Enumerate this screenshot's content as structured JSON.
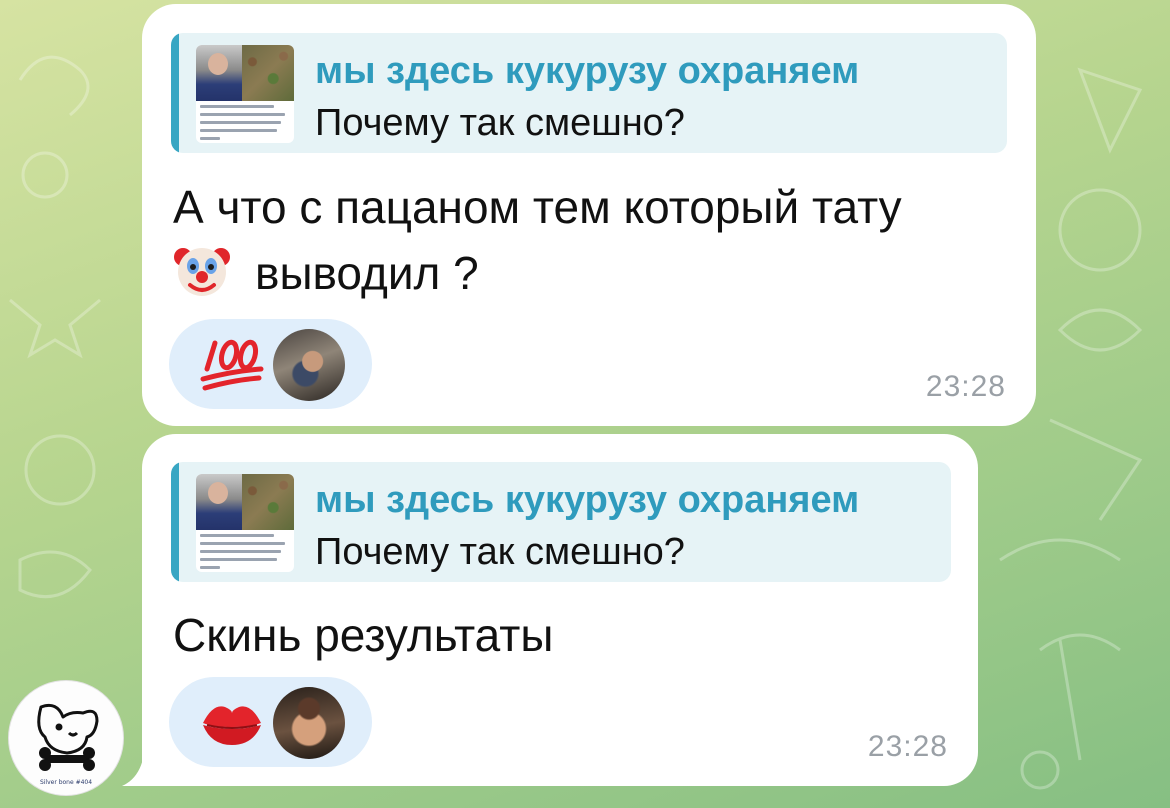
{
  "messages": [
    {
      "reply": {
        "author": "мы здесь кукурузу охраняем",
        "text": "Почему так смешно?"
      },
      "text_line1": "А что с пацаном тем который тату",
      "text_line2": "выводил ?",
      "reactions": [
        {
          "icon": "hundred-points-emoji"
        }
      ],
      "time": "23:28"
    },
    {
      "reply": {
        "author": "мы здесь кукурузу охраняем",
        "text": "Почему так смешно?"
      },
      "text": "Скинь результаты",
      "reactions": [
        {
          "icon": "kiss-mark-emoji"
        }
      ],
      "time": "23:28"
    }
  ],
  "sender": {
    "avatar_caption": "Silver bone #404"
  },
  "colors": {
    "reply_accent": "#38a6c3",
    "reply_author": "#2f9bbd",
    "reply_bg": "#e6f3f6",
    "reaction_bg": "#e0eefb",
    "time": "#9aa0a6"
  }
}
